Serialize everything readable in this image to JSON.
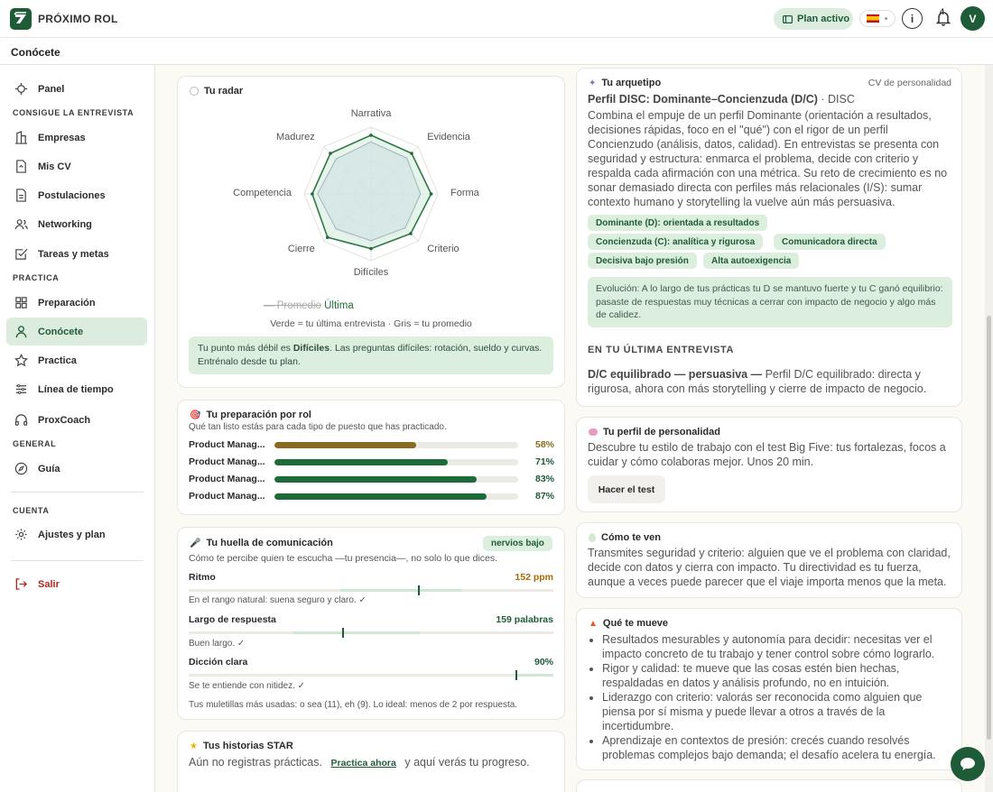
{
  "header": {
    "brand": "PRÓXIMO ROL",
    "plan_label": "Plan activo",
    "notifications": "4",
    "avatar_initial": "V",
    "info_glyph": "i"
  },
  "page": {
    "title": "Conócete"
  },
  "sidebar": {
    "panel": "Panel",
    "section_interview": "CONSIGUE LA ENTREVISTA",
    "empresas": "Empresas",
    "mis_cv": "Mis CV",
    "postulaciones": "Postulaciones",
    "networking": "Networking",
    "tareas": "Tareas y metas",
    "section_practice": "PRACTICA",
    "preparacion": "Preparación",
    "conocete": "Conócete",
    "practica": "Practica",
    "linea": "Línea de tiempo",
    "proxcoach": "ProxCoach",
    "section_general": "GENERAL",
    "guia": "Guía",
    "section_account": "CUENTA",
    "ajustes": "Ajustes y plan",
    "salir": "Salir"
  },
  "radar": {
    "title": "Tu radar",
    "axes": [
      "Narrativa",
      "Evidencia",
      "Forma",
      "Criterio",
      "Difíciles",
      "Cierre",
      "Competencia",
      "Madurez"
    ],
    "latest": [
      0.88,
      0.86,
      0.9,
      0.84,
      0.82,
      0.92,
      0.88,
      0.86
    ],
    "average": [
      0.78,
      0.76,
      0.74,
      0.72,
      0.7,
      0.74,
      0.8,
      0.74
    ],
    "legend_avg": "— Promedio",
    "legend_last": "Última",
    "caption": "Verde = tu última entrevista · Gris = tu promedio",
    "tip_pre": "Tu punto más débil es ",
    "tip_bold": "Difíciles",
    "tip_post": ". Las preguntas difíciles: rotación, sueldo y curvas. Entrénalo desde tu plan."
  },
  "prep": {
    "title": "Tu preparación por rol",
    "subtitle": "Qué tan listo estás para cada tipo de puesto que has practicado.",
    "rows": [
      {
        "label": "Product Manag...",
        "pct": 58,
        "pct_label": "58%",
        "color": "#8a6a1e"
      },
      {
        "label": "Product Manag...",
        "pct": 71,
        "pct_label": "71%",
        "color": "#1e6b3a"
      },
      {
        "label": "Product Manag...",
        "pct": 83,
        "pct_label": "83%",
        "color": "#1e6b3a"
      },
      {
        "label": "Product Manag...",
        "pct": 87,
        "pct_label": "87%",
        "color": "#1e6b3a"
      }
    ]
  },
  "huella": {
    "title": "Tu huella de comunicación",
    "badge": "nervios bajo",
    "subtitle": "Cómo te percibe quien te escucha —tu presencia—, no solo lo que dices.",
    "ritmo_label": "Ritmo",
    "ritmo_value": "152 ppm",
    "ritmo_note": "En el rango natural: suena seguro y claro. ✓",
    "largo_label": "Largo de respuesta",
    "largo_value": "159 palabras",
    "largo_note": "Buen largo. ✓",
    "diccion_label": "Dicción clara",
    "diccion_value": "90%",
    "diccion_note": "Se te entiende con nitidez. ✓",
    "muletillas": "Tus muletillas más usadas: o sea (11), eh (9). Lo ideal: menos de 2 por respuesta."
  },
  "star": {
    "title": "Tus historias STAR",
    "text_pre": "Aún no registras prácticas.",
    "link": "Practica ahora",
    "text_post": "y aquí verás tu progreso."
  },
  "arquetipo": {
    "title": "Tu arquetipo",
    "source": "CV de personalidad",
    "profile_bold": "Perfil DISC: Dominante–Concienzuda (D/C)",
    "profile_tail": " · DISC",
    "description": "Combina el empuje de un perfil Dominante (orientación a resultados, decisiones rápidas, foco en el \"qué\") con el rigor de un perfil Concienzudo (análisis, datos, calidad). En entrevistas se presenta con seguridad y estructura: enmarca el problema, decide con criterio y respalda cada afirmación con una métrica. Su reto de crecimiento es no sonar demasiado directa con perfiles más relacionales (I/S): sumar contexto humano y storytelling la vuelve aún más persuasiva.",
    "chips": [
      "Dominante (D): orientada a resultados",
      "Concienzuda (C): analítica y rigurosa",
      "Comunicadora directa",
      "Decisiva bajo presión",
      "Alta autoexigencia"
    ],
    "evolution": "Evolución: A lo largo de tus prácticas tu D se mantuvo fuerte y tu C ganó equilibrio: pasaste de respuestas muy técnicas a cerrar con impacto de negocio y algo más de calidez.",
    "last_heading": "EN TU ÚLTIMA ENTREVISTA",
    "last_bold": "D/C equilibrado — persuasiva —",
    "last_text": " Perfil D/C equilibrado: directa y rigurosa, ahora con más storytelling y cierre de impacto de negocio."
  },
  "personalidad": {
    "title": "Tu perfil de personalidad",
    "text": "Descubre tu estilo de trabajo con el test Big Five: tus fortalezas, focos a cuidar y cómo colaboras mejor. Unos 20 min.",
    "button": "Hacer el test"
  },
  "ven": {
    "title": "Cómo te ven",
    "text": "Transmites seguridad y criterio: alguien que ve el problema con claridad, decide con datos y cierra con impacto. Tu directividad es tu fuerza, aunque a veces puede parecer que el viaje importa menos que la meta."
  },
  "mueve": {
    "title": "Qué te mueve",
    "items": [
      "Resultados mesurables y autonomía para decidir: necesitas ver el impacto concreto de tu trabajo y tener control sobre cómo lograrlo.",
      "Rigor y calidad: te mueve que las cosas estén bien hechas, respaldadas en datos y análisis profundo, no en intuición.",
      "Liderazgo con criterio: valorás ser reconocida como alguien que piensa por sí misma y puede llevar a otros a través de la incertidumbre.",
      "Aprendizaje en contextos de presión: crecés cuando resolvés problemas complejos bajo demanda; el desafío acelera tu energía."
    ]
  },
  "colors": {
    "brand": "#1e5b37",
    "accent_light": "#dcecdf",
    "warning": "#a36a00"
  }
}
